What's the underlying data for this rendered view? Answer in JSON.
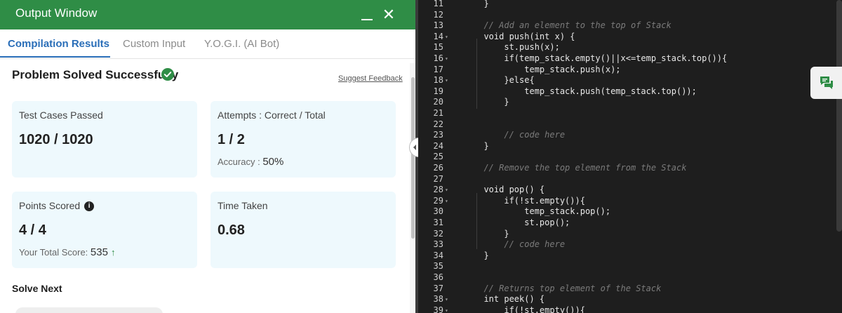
{
  "window": {
    "title": "Output Window",
    "minimize_icon": "minimize-icon",
    "close_icon": "close-icon"
  },
  "tabs": [
    {
      "label": "Compilation Results",
      "active": true
    },
    {
      "label": "Custom Input",
      "active": false
    },
    {
      "label": "Y.O.G.I. (AI Bot)",
      "active": false
    }
  ],
  "result": {
    "title": "Problem Solved Successfully",
    "status_icon": "check-circle-icon",
    "suggest_link": "Suggest Feedback"
  },
  "cards": {
    "test_cases": {
      "label": "Test Cases Passed",
      "value": "1020 / 1020"
    },
    "attempts": {
      "label": "Attempts : Correct / Total",
      "value": "1 / 2",
      "accuracy_label": "Accuracy :",
      "accuracy_value": "50%"
    },
    "points": {
      "label": "Points Scored",
      "value": "4 / 4",
      "total_label": "Your Total Score:",
      "total_value": "535",
      "info_icon": "i"
    },
    "time": {
      "label": "Time Taken",
      "value": "0.68"
    }
  },
  "solve_next": {
    "title": "Solve Next"
  },
  "colors": {
    "brand_green": "#2f8d46",
    "tab_active": "#2a6eb8",
    "card_bg": "#eef9fd",
    "editor_bg": "#1e1e1e"
  },
  "editor": {
    "lines": [
      {
        "n": "11",
        "text": "  }",
        "fold": false
      },
      {
        "n": "12",
        "text": "",
        "fold": false
      },
      {
        "n": "13",
        "text": "  // Add an element to the top of Stack",
        "fold": false,
        "comment": true
      },
      {
        "n": "14",
        "text": "  void push(int x) {",
        "fold": true
      },
      {
        "n": "15",
        "text": "      st.push(x);",
        "fold": false
      },
      {
        "n": "16",
        "text": "      if(temp_stack.empty()||x<=temp_stack.top()){",
        "fold": true
      },
      {
        "n": "17",
        "text": "          temp_stack.push(x);",
        "fold": false
      },
      {
        "n": "18",
        "text": "      }else{",
        "fold": true
      },
      {
        "n": "19",
        "text": "          temp_stack.push(temp_stack.top());",
        "fold": false
      },
      {
        "n": "20",
        "text": "      }",
        "fold": false
      },
      {
        "n": "21",
        "text": "",
        "fold": false
      },
      {
        "n": "22",
        "text": "",
        "fold": false
      },
      {
        "n": "23",
        "text": "      // code here",
        "fold": false,
        "comment": true
      },
      {
        "n": "24",
        "text": "  }",
        "fold": false
      },
      {
        "n": "25",
        "text": "",
        "fold": false
      },
      {
        "n": "26",
        "text": "  // Remove the top element from the Stack",
        "fold": false,
        "comment": true
      },
      {
        "n": "27",
        "text": "",
        "fold": false
      },
      {
        "n": "28",
        "text": "  void pop() {",
        "fold": true
      },
      {
        "n": "29",
        "text": "      if(!st.empty()){",
        "fold": true
      },
      {
        "n": "30",
        "text": "          temp_stack.pop();",
        "fold": false
      },
      {
        "n": "31",
        "text": "          st.pop();",
        "fold": false
      },
      {
        "n": "32",
        "text": "      }",
        "fold": false
      },
      {
        "n": "33",
        "text": "      // code here",
        "fold": false,
        "comment": true
      },
      {
        "n": "34",
        "text": "  }",
        "fold": false
      },
      {
        "n": "35",
        "text": "",
        "fold": false
      },
      {
        "n": "36",
        "text": "",
        "fold": false
      },
      {
        "n": "37",
        "text": "  // Returns top element of the Stack",
        "fold": false,
        "comment": true
      },
      {
        "n": "38",
        "text": "  int peek() {",
        "fold": true
      },
      {
        "n": "39",
        "text": "      if(!st.empty()){",
        "fold": true
      }
    ],
    "chat_icon": "chat-icon",
    "split_icon": "split-resize-icon"
  }
}
